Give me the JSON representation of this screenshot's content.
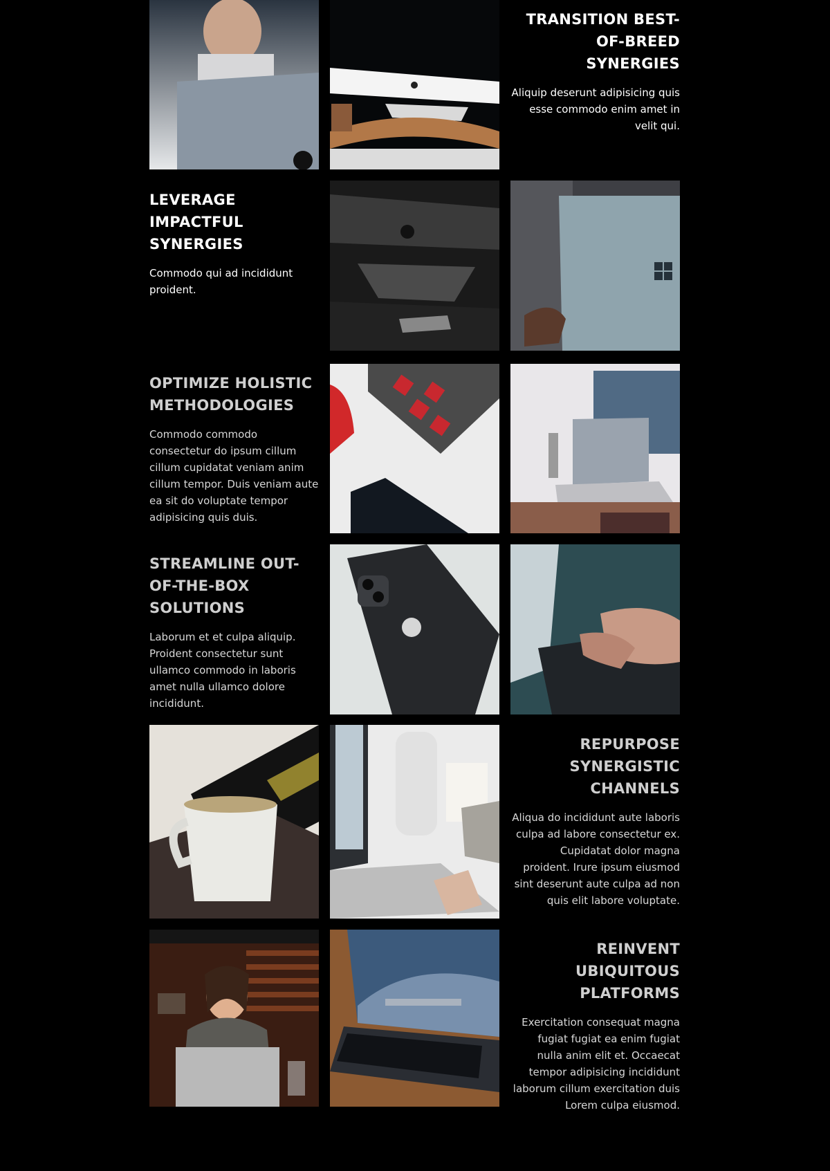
{
  "rows": [
    {
      "heading": "Transition best-of-breed synergies",
      "text": "Aliquip deserunt adipisicing quis esse commodo enim amet in velit qui.",
      "align": "right",
      "images": [
        {
          "icon": "man-with-laptop-photo"
        },
        {
          "icon": "imac-on-wooden-stand-photo"
        }
      ]
    },
    {
      "heading": "Leverage impactful synergies",
      "text": "Commodo qui ad incididunt proident.",
      "align": "left",
      "images": [
        {
          "icon": "dark-imac-and-iphone-photo"
        },
        {
          "icon": "surface-laptop-photo"
        }
      ]
    },
    {
      "heading": "Optimize holistic methodologies",
      "text": "Commodo commodo consectetur do ipsum cillum cillum cupidatat veniam anim cillum tempor. Duis veniam aute ea sit do voluptate tempor adipisicing quis duis.",
      "align": "left",
      "images": [
        {
          "icon": "keyboard-and-phone-photo"
        },
        {
          "icon": "laptop-workspace-photo"
        }
      ]
    },
    {
      "heading": "Streamline out-of-the-box solutions",
      "text": "Laborum et et culpa aliquip. Proident consectetur sunt ullamco commodo in laboris amet nulla ullamco dolore incididunt.",
      "align": "left",
      "images": [
        {
          "icon": "iphone-on-desk-photo"
        },
        {
          "icon": "typing-hands-photo"
        }
      ]
    },
    {
      "heading": "Repurpose synergistic channels",
      "text": "Aliqua do incididunt aute laboris culpa ad labore consectetur ex. Cupidatat dolor magna proident. Irure ipsum eiusmod sint deserunt aute culpa ad non quis elit labore voluptate.",
      "align": "right",
      "images": [
        {
          "icon": "coffee-mug-keyboard-photo"
        },
        {
          "icon": "laptop-glasses-desk-photo"
        }
      ]
    },
    {
      "heading": "Reinvent ubiquitous platforms",
      "text": "Exercitation consequat magna fugiat fugiat ea enim fugiat nulla anim elit et. Occaecat tempor adipisicing incididunt laborum cillum exercitation duis Lorem culpa eiusmod.",
      "align": "right",
      "images": [
        {
          "icon": "smiling-man-laptop-photo"
        },
        {
          "icon": "macbook-wallpaper-photo"
        }
      ]
    }
  ]
}
